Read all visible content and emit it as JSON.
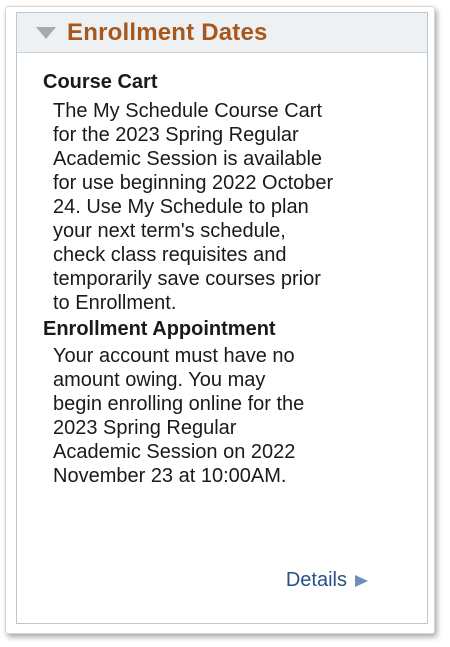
{
  "panel": {
    "title": "Enrollment Dates",
    "collapse_icon": "triangle-down-icon",
    "title_color": "#a8571c"
  },
  "sections": [
    {
      "heading": "Course Cart",
      "text": "The My Schedule Course Cart\nfor the 2023 Spring Regular\nAcademic Session is available\nfor use beginning 2022 October\n24. Use My Schedule to plan\nyour next term's schedule,\ncheck class requisites and\ntemporarily save courses prior\nto Enrollment."
    },
    {
      "heading": "Enrollment Appointment",
      "text": "Your account must have no\namount owing. You may\nbegin enrolling online for the\n2023 Spring Regular\nAcademic Session on 2022\nNovember 23 at 10:00AM."
    }
  ],
  "details": {
    "label": "Details",
    "icon": "triangle-right-icon",
    "color": "#2b4f86"
  }
}
